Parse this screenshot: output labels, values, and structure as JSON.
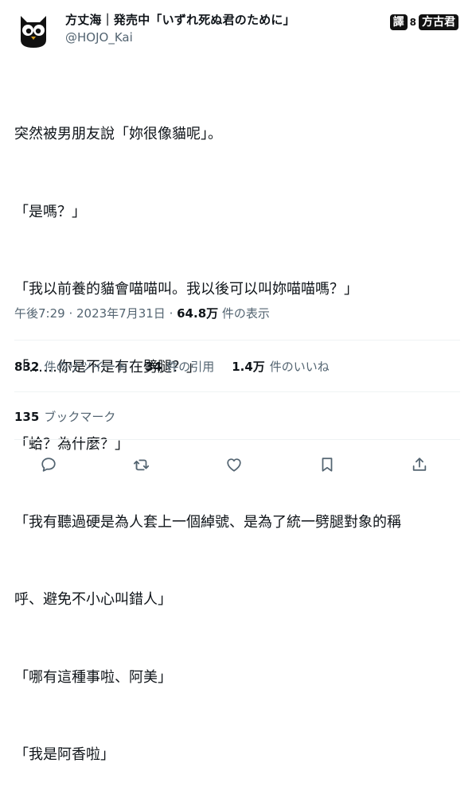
{
  "author": {
    "display_name": "方丈海｜発売中「いずれ死ぬ君のために」",
    "handle": "@HOJO_Kai"
  },
  "translator_badge": {
    "tag": "譯",
    "separator": "8",
    "name": "方古君"
  },
  "tweet": {
    "lines": [
      "突然被男朋友說「妳很像貓呢」。",
      "「是嗎？」",
      "「我以前養的貓會喵喵叫。我以後可以叫妳喵喵嗎？」",
      "「……你是不是有在劈腿？」",
      "「蛤？為什麼？」",
      "「我有聽過硬是為人套上一個綽號、是為了統一劈腿對象的稱",
      "呼、避免不小心叫錯人」",
      "「哪有這種事啦、阿美」",
      "「我是阿香啦」"
    ]
  },
  "meta": {
    "time": "午後7:29",
    "separator": " · ",
    "date": "2023年7月31日",
    "separator2": " · ",
    "views": "64.8万",
    "views_label": " 件の表示"
  },
  "stats": {
    "retweets": {
      "num": "832",
      "label": "件のリツイート"
    },
    "quotes": {
      "num": "34",
      "label": "件の引用"
    },
    "likes": {
      "num": "1.4万",
      "label": "件のいいね"
    }
  },
  "bookmarks": {
    "num": "135",
    "label": "ブックマーク"
  },
  "actions": {
    "icons": [
      "reply-icon",
      "retweet-icon",
      "like-icon",
      "bookmark-icon",
      "share-icon"
    ]
  },
  "colors": {
    "text_primary": "#0f1419",
    "text_secondary": "#536471",
    "divider": "#eff3f4",
    "icon": "#536471"
  }
}
